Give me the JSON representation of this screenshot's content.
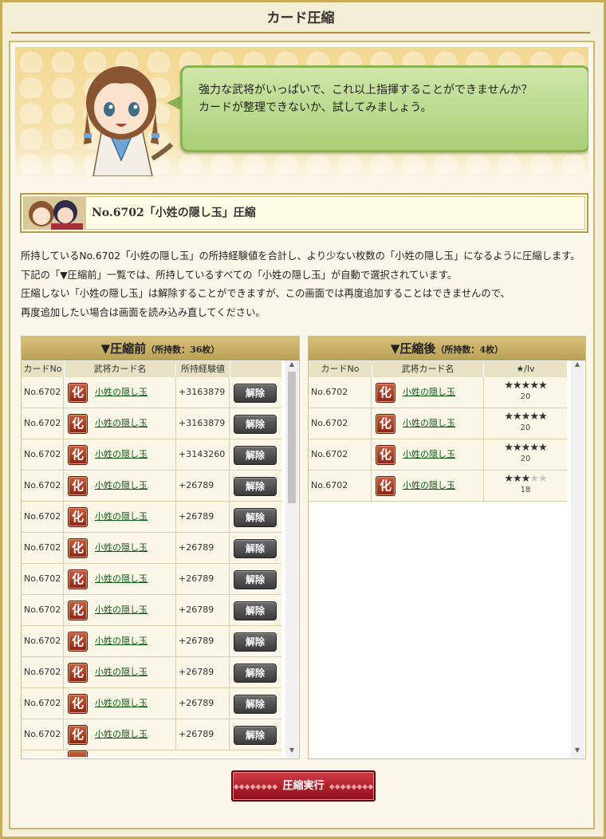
{
  "title": "カード圧縮",
  "speech": [
    "強力な武将がいっぱいで、これ以上指揮することができませんか？",
    "カードが整理できないか、試してみましょう。"
  ],
  "item_header": "No.6702「小姓の隠し玉」圧縮",
  "description": [
    "所持しているNo.6702「小姓の隠し玉」の所持経験値を合計し、より少ない枚数の「小姓の隠し玉」になるように圧縮します。",
    "下記の「▼圧縮前」一覧では、所持しているすべての「小姓の隠し玉」が自動で選択されています。",
    "圧縮しない「小姓の隠し玉」は解除することができますが、この画面では再度追加することはできませんので、",
    "再度追加したい場合は画面を読み込み直してください。"
  ],
  "before": {
    "heading": "▼圧縮前",
    "count": "（所持数：36枚）",
    "columns": [
      "カードNo",
      "武将カード名",
      "所持経験値",
      ""
    ],
    "rows": [
      {
        "no": "No.6702",
        "icon": "化",
        "name": "小姓の隠し玉",
        "exp": "+3163879",
        "action": "解除"
      },
      {
        "no": "No.6702",
        "icon": "化",
        "name": "小姓の隠し玉",
        "exp": "+3163879",
        "action": "解除"
      },
      {
        "no": "No.6702",
        "icon": "化",
        "name": "小姓の隠し玉",
        "exp": "+3143260",
        "action": "解除"
      },
      {
        "no": "No.6702",
        "icon": "化",
        "name": "小姓の隠し玉",
        "exp": "+26789",
        "action": "解除"
      },
      {
        "no": "No.6702",
        "icon": "化",
        "name": "小姓の隠し玉",
        "exp": "+26789",
        "action": "解除"
      },
      {
        "no": "No.6702",
        "icon": "化",
        "name": "小姓の隠し玉",
        "exp": "+26789",
        "action": "解除"
      },
      {
        "no": "No.6702",
        "icon": "化",
        "name": "小姓の隠し玉",
        "exp": "+26789",
        "action": "解除"
      },
      {
        "no": "No.6702",
        "icon": "化",
        "name": "小姓の隠し玉",
        "exp": "+26789",
        "action": "解除"
      },
      {
        "no": "No.6702",
        "icon": "化",
        "name": "小姓の隠し玉",
        "exp": "+26789",
        "action": "解除"
      },
      {
        "no": "No.6702",
        "icon": "化",
        "name": "小姓の隠し玉",
        "exp": "+26789",
        "action": "解除"
      },
      {
        "no": "No.6702",
        "icon": "化",
        "name": "小姓の隠し玉",
        "exp": "+26789",
        "action": "解除"
      },
      {
        "no": "No.6702",
        "icon": "化",
        "name": "小姓の隠し玉",
        "exp": "+26789",
        "action": "解除"
      }
    ]
  },
  "after": {
    "heading": "▼圧縮後",
    "count": "（所持数：4枚）",
    "columns": [
      "カードNo",
      "武将カード名",
      "★/lv"
    ],
    "rows": [
      {
        "no": "No.6702",
        "icon": "化",
        "name": "小姓の隠し玉",
        "stars": 5,
        "lv": "20"
      },
      {
        "no": "No.6702",
        "icon": "化",
        "name": "小姓の隠し玉",
        "stars": 5,
        "lv": "20"
      },
      {
        "no": "No.6702",
        "icon": "化",
        "name": "小姓の隠し玉",
        "stars": 5,
        "lv": "20"
      },
      {
        "no": "No.6702",
        "icon": "化",
        "name": "小姓の隠し玉",
        "stars": 3,
        "lv": "18"
      }
    ]
  },
  "execute_label": "圧縮実行",
  "colors": {
    "accent": "#b9a055",
    "link": "#0b5d12",
    "execute": "#b31e2a",
    "bubble": "#b5d888"
  }
}
